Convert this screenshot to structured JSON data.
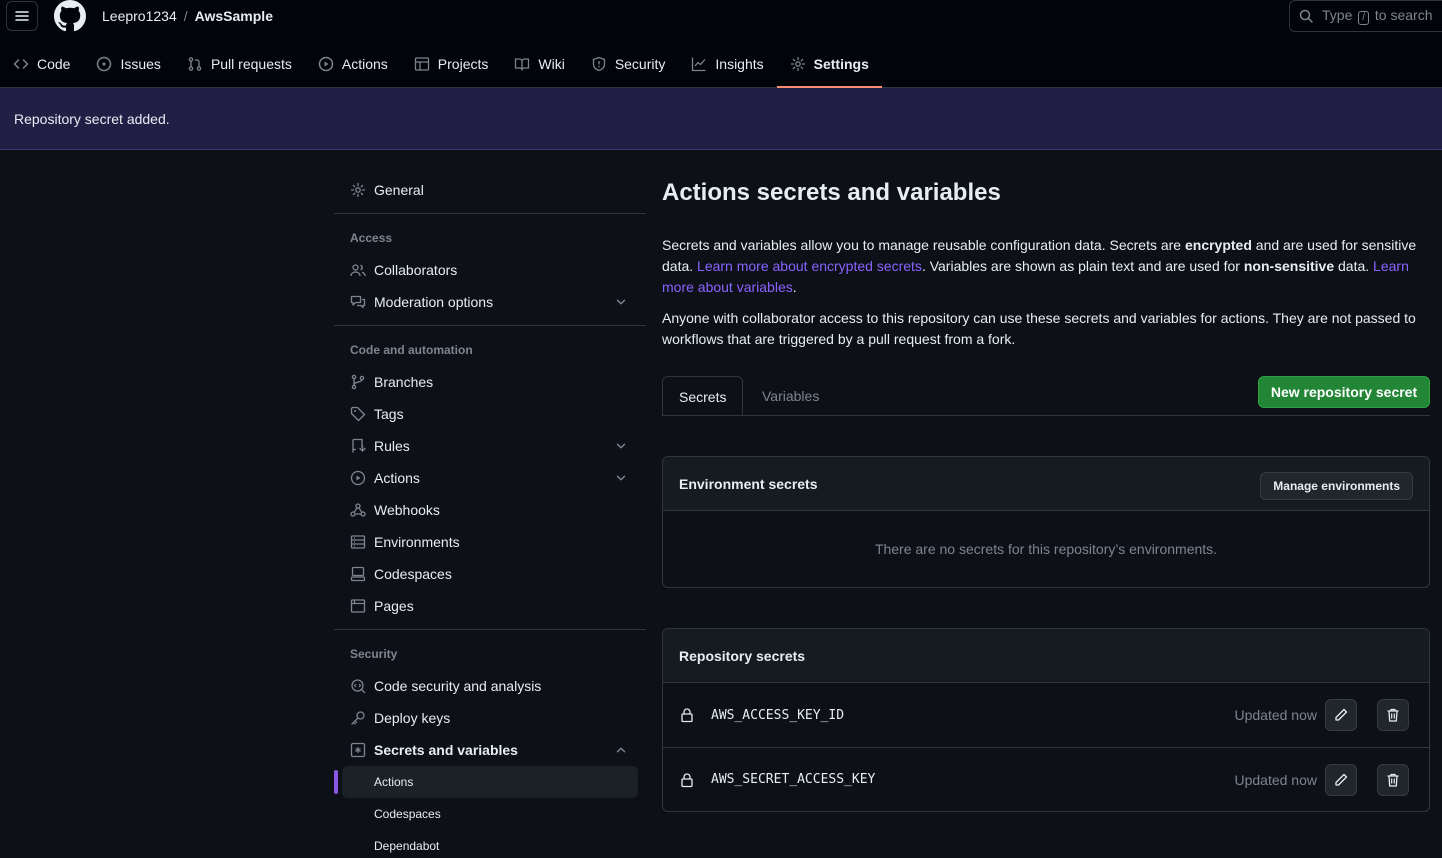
{
  "header": {
    "owner": "Leepro1234",
    "separator": "/",
    "repo": "AwsSample",
    "search_before": "Type",
    "search_key": "/",
    "search_after": "to search"
  },
  "nav": {
    "items": [
      "Code",
      "Issues",
      "Pull requests",
      "Actions",
      "Projects",
      "Wiki",
      "Security",
      "Insights",
      "Settings"
    ],
    "active": "Settings"
  },
  "flash": {
    "message": "Repository secret added."
  },
  "sidebar": {
    "general": "General",
    "access_heading": "Access",
    "collaborators": "Collaborators",
    "moderation": "Moderation options",
    "code_heading": "Code and automation",
    "branches": "Branches",
    "tags": "Tags",
    "rules": "Rules",
    "actions": "Actions",
    "webhooks": "Webhooks",
    "environments": "Environments",
    "codespaces": "Codespaces",
    "pages": "Pages",
    "security_heading": "Security",
    "code_security": "Code security and analysis",
    "deploy_keys": "Deploy keys",
    "secrets": "Secrets and variables",
    "sub_actions": "Actions",
    "sub_codespaces": "Codespaces",
    "sub_dependabot": "Dependabot"
  },
  "main": {
    "title": "Actions secrets and variables",
    "p1_a": "Secrets and variables allow you to manage reusable configuration data. Secrets are ",
    "p1_b": "encrypted",
    "p1_c": " and are used for sensitive data. ",
    "p1_link1": "Learn more about encrypted secrets",
    "p1_d": ". Variables are shown as plain text and are used for ",
    "p1_e": "non-sensitive",
    "p1_f": " data. ",
    "p1_link2": "Learn more about variables",
    "p1_g": ".",
    "p2": "Anyone with collaborator access to this repository can use these secrets and variables for actions. They are not passed to workflows that are triggered by a pull request from a fork.",
    "tab_secrets": "Secrets",
    "tab_variables": "Variables",
    "new_secret": "New repository secret",
    "env_title": "Environment secrets",
    "manage_env": "Manage environments",
    "env_empty": "There are no secrets for this repository’s environments.",
    "repo_title": "Repository secrets",
    "secrets": [
      {
        "name": "AWS_ACCESS_KEY_ID",
        "updated": "Updated now"
      },
      {
        "name": "AWS_SECRET_ACCESS_KEY",
        "updated": "Updated now"
      }
    ]
  },
  "colors": {
    "accent_underline": "#fd8c73",
    "green": "#238636",
    "flash_bg": "#211f45",
    "link": "#8a63ff"
  }
}
